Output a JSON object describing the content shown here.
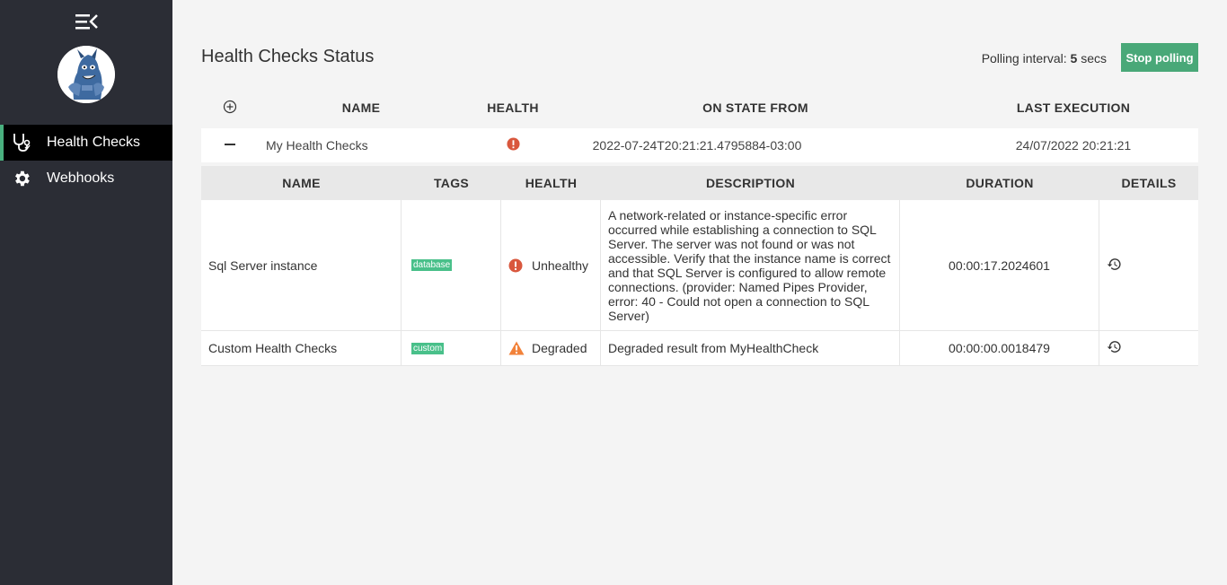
{
  "sidebar": {
    "items": [
      {
        "label": "Health Checks",
        "icon": "stethoscope-icon",
        "active": true
      },
      {
        "label": "Webhooks",
        "icon": "gear-icon",
        "active": false
      }
    ]
  },
  "page": {
    "title": "Health Checks Status",
    "polling_label": "Polling interval:",
    "polling_value": "5",
    "polling_unit": "secs",
    "stop_button": "Stop polling"
  },
  "outer_table": {
    "headers": [
      "NAME",
      "HEALTH",
      "ON STATE FROM",
      "LAST EXECUTION"
    ],
    "row": {
      "name": "My Health Checks",
      "health": "Unhealthy",
      "on_state_from": "2022-07-24T20:21:21.4795884-03:00",
      "last_execution": "24/07/2022 20:21:21"
    }
  },
  "inner_table": {
    "headers": [
      "NAME",
      "TAGS",
      "HEALTH",
      "DESCRIPTION",
      "DURATION",
      "DETAILS"
    ],
    "rows": [
      {
        "name": "Sql Server instance",
        "tag": "database",
        "health": "Unhealthy",
        "description": "A network-related or instance-specific error occurred while establishing a connection to SQL Server. The server was not found or was not accessible. Verify that the instance name is correct and that SQL Server is configured to allow remote connections. (provider: Named Pipes Provider, error: 40 - Could not open a connection to SQL Server)",
        "duration": "00:00:17.2024601"
      },
      {
        "name": "Custom Health Checks",
        "tag": "custom",
        "health": "Degraded",
        "description": "Degraded result from MyHealthCheck",
        "duration": "00:00:00.0018479"
      }
    ]
  },
  "colors": {
    "sidebar_bg": "#2b2d35",
    "accent": "#49a878",
    "unhealthy": "#d9573d",
    "degraded": "#f2823a"
  }
}
